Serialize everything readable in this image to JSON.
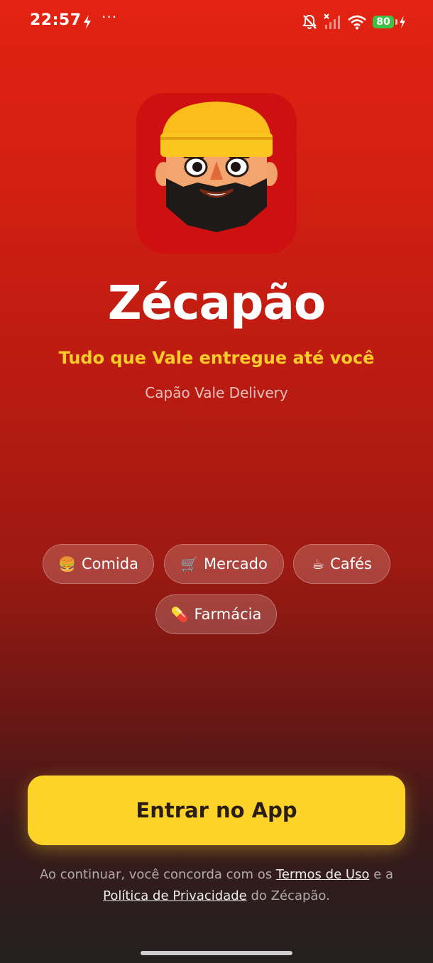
{
  "status_bar": {
    "time": "22:57",
    "dots": "···",
    "battery_level": "80",
    "icons": [
      "charging-bolt-icon",
      "bell-muted-icon",
      "signal-off-icon",
      "wifi-icon",
      "battery-icon"
    ]
  },
  "app": {
    "title": "Zécapão",
    "tagline": "Tudo que Vale entregue até você",
    "subtitle": "Capão Vale Delivery"
  },
  "categories": [
    {
      "icon": "🍔",
      "label": "Comida"
    },
    {
      "icon": "🛒",
      "label": "Mercado"
    },
    {
      "icon": "☕",
      "label": "Cafés"
    },
    {
      "icon": "💊",
      "label": "Farmácia"
    }
  ],
  "cta": {
    "label": "Entrar no App"
  },
  "legal": {
    "prefix": "Ao continuar, você concorda com os ",
    "terms": "Termos de Uso",
    "middle": " e a ",
    "privacy": "Política de Privacidade",
    "suffix": " do Zécapão."
  },
  "colors": {
    "brand_red": "#e32312",
    "accent_yellow": "#fdd329",
    "tagline_yellow": "#ffcc28"
  }
}
